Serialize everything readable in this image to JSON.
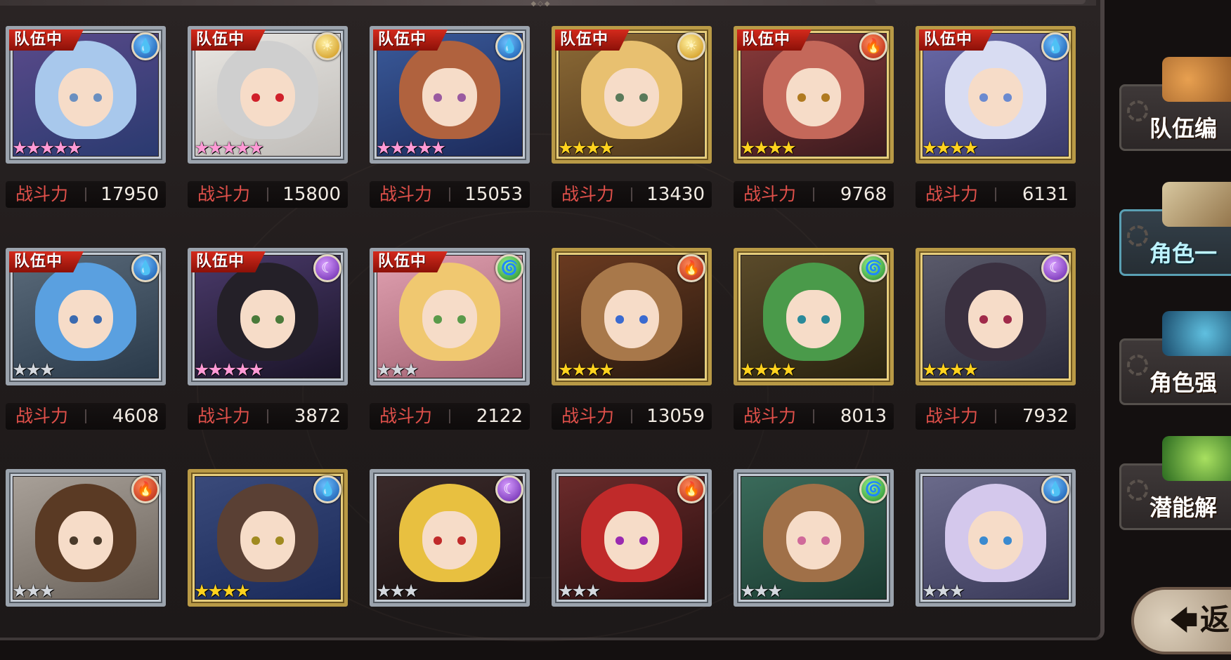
{
  "badge_text": "队伍中",
  "power_label": "战斗力",
  "characters": [
    {
      "in_team": true,
      "element": "water-icon",
      "rarity": 5,
      "frame": "silver",
      "power": "17950"
    },
    {
      "in_team": true,
      "element": "light-icon",
      "rarity": 5,
      "frame": "silver",
      "power": "15800"
    },
    {
      "in_team": true,
      "element": "water-icon",
      "rarity": 5,
      "frame": "silver",
      "power": "15053"
    },
    {
      "in_team": true,
      "element": "light-icon",
      "rarity": 4,
      "frame": "gold",
      "power": "13430"
    },
    {
      "in_team": true,
      "element": "fire-icon",
      "rarity": 4,
      "frame": "gold",
      "power": "9768"
    },
    {
      "in_team": true,
      "element": "water-icon",
      "rarity": 4,
      "frame": "gold",
      "power": "6131"
    },
    {
      "in_team": true,
      "element": "water-icon",
      "rarity": 3,
      "frame": "silver",
      "power": "4608"
    },
    {
      "in_team": true,
      "element": "dark-icon",
      "rarity": 5,
      "frame": "silver",
      "power": "3872"
    },
    {
      "in_team": true,
      "element": "wind-icon",
      "rarity": 3,
      "frame": "silver",
      "power": "2122"
    },
    {
      "in_team": false,
      "element": "fire-icon",
      "rarity": 4,
      "frame": "gold",
      "power": "13059"
    },
    {
      "in_team": false,
      "element": "wind-icon",
      "rarity": 4,
      "frame": "gold",
      "power": "8013"
    },
    {
      "in_team": false,
      "element": "dark-icon",
      "rarity": 4,
      "frame": "gold",
      "power": "7932"
    },
    {
      "in_team": false,
      "element": "fire-icon",
      "rarity": 3,
      "frame": "silver",
      "power": ""
    },
    {
      "in_team": false,
      "element": "water-icon",
      "rarity": 4,
      "frame": "gold",
      "power": ""
    },
    {
      "in_team": false,
      "element": "dark-icon",
      "rarity": 3,
      "frame": "silver",
      "power": ""
    },
    {
      "in_team": false,
      "element": "fire-icon",
      "rarity": 3,
      "frame": "silver",
      "power": ""
    },
    {
      "in_team": false,
      "element": "wind-icon",
      "rarity": 3,
      "frame": "silver",
      "power": ""
    },
    {
      "in_team": false,
      "element": "water-icon",
      "rarity": 3,
      "frame": "silver",
      "power": ""
    }
  ],
  "side_menu": [
    {
      "label": "队伍编",
      "active": false
    },
    {
      "label": "角色一",
      "active": true
    },
    {
      "label": "角色强",
      "active": false
    },
    {
      "label": "潜能解",
      "active": false
    }
  ],
  "back_button": {
    "label": "返"
  },
  "colors": {
    "badge_red": "#c81e12",
    "power_label": "#e0504a",
    "water": "#1a6fd0",
    "fire": "#d8361a",
    "light": "#e0a818",
    "dark": "#8a3ad0",
    "wind": "#28a838"
  }
}
